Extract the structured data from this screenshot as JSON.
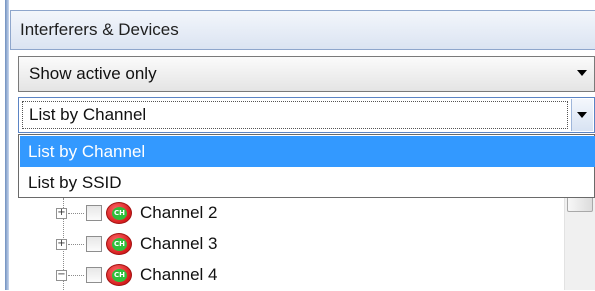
{
  "panel": {
    "title": "Interferers & Devices"
  },
  "filter_combo": {
    "value": "Show active only"
  },
  "list_combo": {
    "value": "List by Channel",
    "options": [
      {
        "label": "List by Channel",
        "selected": true
      },
      {
        "label": "List by SSID",
        "selected": false
      }
    ]
  },
  "tree": {
    "items": [
      {
        "label": "Channel 2",
        "expander": "+",
        "icon": "channel-icon"
      },
      {
        "label": "Channel 3",
        "expander": "+",
        "icon": "channel-icon"
      },
      {
        "label": "Channel 4",
        "expander": "−",
        "icon": "channel-icon"
      }
    ],
    "icon_text": "CH"
  },
  "colors": {
    "selection": "#3399ff",
    "header_border": "#8ea6cc",
    "channel_icon_outer": "#d51b1b",
    "channel_icon_inner": "#2fbf3a"
  }
}
